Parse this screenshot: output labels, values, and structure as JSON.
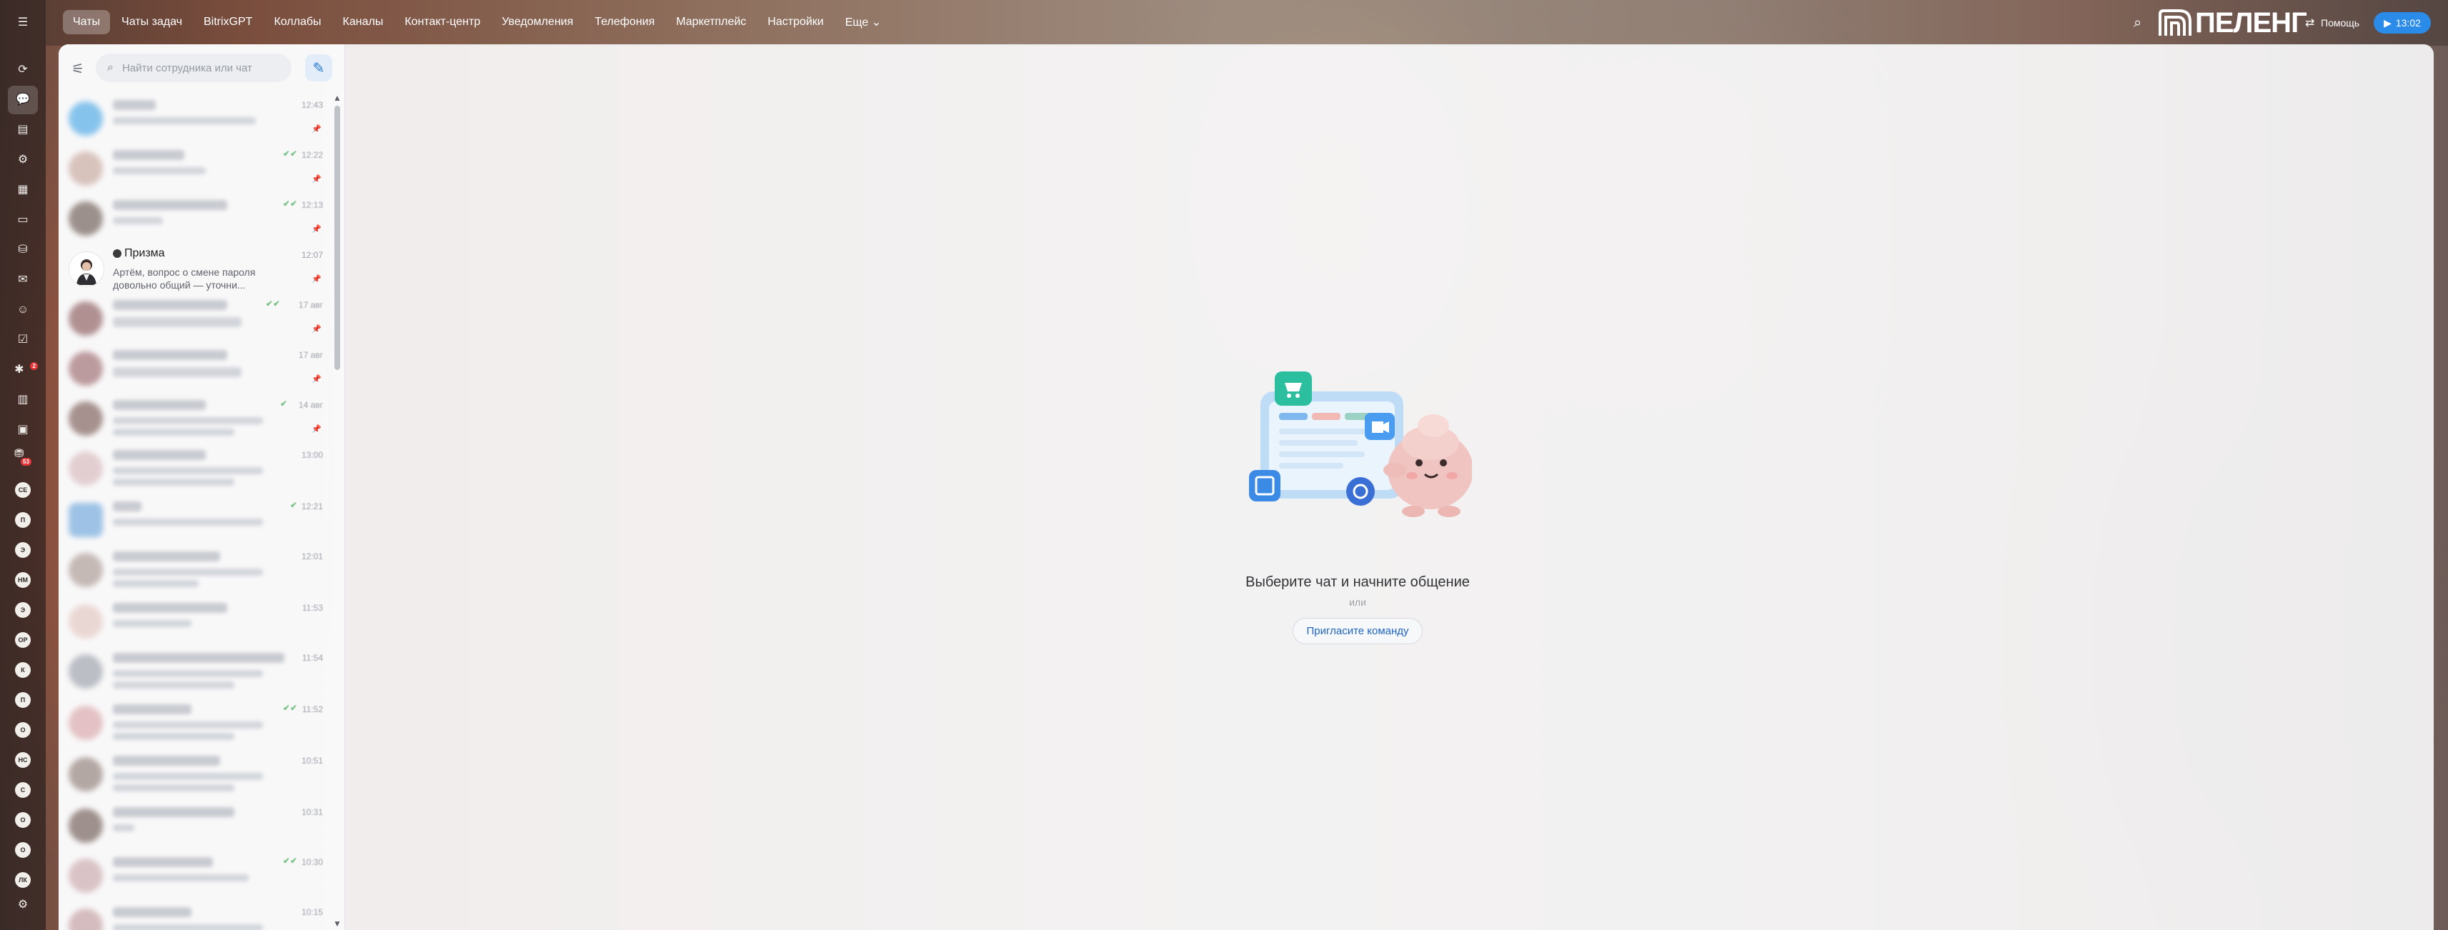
{
  "topnav": {
    "items": [
      "Чаты",
      "Чаты задач",
      "BitrixGPT",
      "Коллабы",
      "Каналы",
      "Контакт-центр",
      "Уведомления",
      "Телефония",
      "Маркетплейс",
      "Настройки",
      "Еще ⌄"
    ],
    "active": "Чаты"
  },
  "header": {
    "logo_text": "ПЕЛЕНГ",
    "help_label": "Помощь",
    "time": "13:02"
  },
  "rail": {
    "badges": {
      "b1": "2",
      "b2": "53"
    },
    "avatars": [
      "СЕ",
      "П",
      "Э",
      "НМ",
      "Э",
      "ОР",
      "К",
      "П",
      "О",
      "НС",
      "С",
      "О",
      "О",
      "ЛК"
    ]
  },
  "sidebar": {
    "search_placeholder": "Найти сотрудника или чат",
    "chats": [
      {
        "time": "12:43"
      },
      {
        "time": "12:22"
      },
      {
        "time": "12:13"
      },
      {
        "title": "Призма",
        "message": "Артём, вопрос о смене пароля довольно общий — уточни...",
        "time": "12:07"
      },
      {
        "time": "17 авг"
      },
      {
        "time": "17 авг"
      },
      {
        "time": "14 авг"
      },
      {
        "time": "13:00"
      },
      {
        "time": "12:21"
      },
      {
        "time": "12:01"
      },
      {
        "time": "11:53"
      },
      {
        "time": "11:54"
      },
      {
        "time": "11:52"
      },
      {
        "time": "10:51"
      },
      {
        "time": "10:31"
      },
      {
        "time": "10:30"
      },
      {
        "time": "10:15"
      }
    ]
  },
  "empty_state": {
    "title": "Выберите чат и начните общение",
    "or": "или",
    "invite_label": "Пригласите команду"
  }
}
